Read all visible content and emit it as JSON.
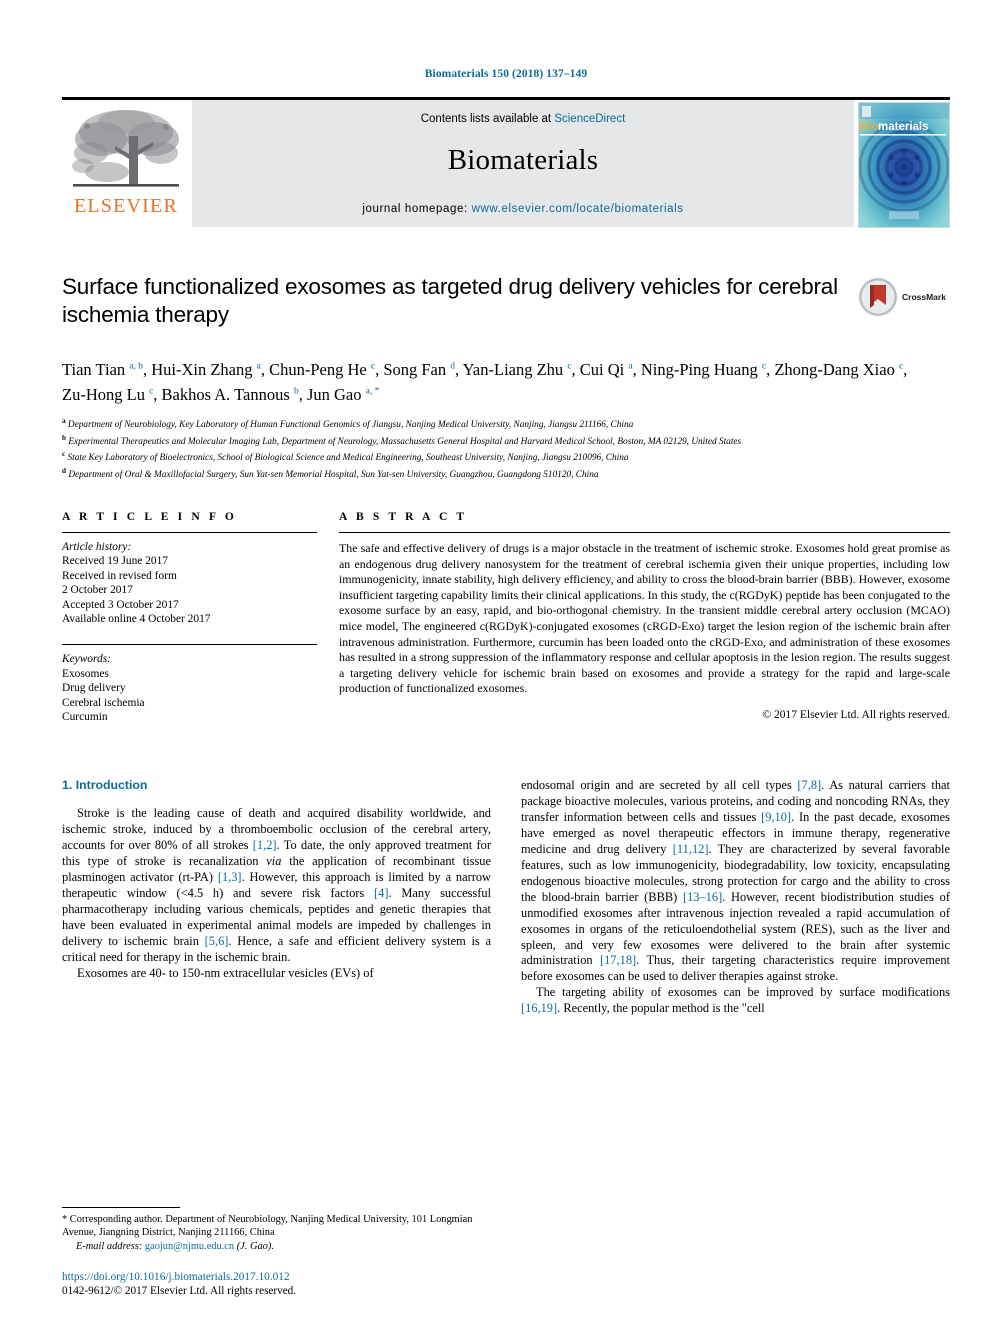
{
  "running_head": "Biomaterials 150 (2018) 137–149",
  "masthead": {
    "publisher_name": "ELSEVIER",
    "contents_prefix": "Contents lists available at ",
    "contents_link": "ScienceDirect",
    "journal_title": "Biomaterials",
    "homepage_prefix": "journal homepage: ",
    "homepage_url": "www.elsevier.com/locate/biomaterials",
    "cover_title": "Biomaterials",
    "cover_title_prefix": "Bio",
    "cover_title_suffix": "materials"
  },
  "article": {
    "title": "Surface functionalized exosomes as targeted drug delivery vehicles for cerebral ischemia therapy",
    "crossmark_label": "CrossMark"
  },
  "authors": [
    {
      "name": "Tian Tian",
      "sup": "a, b",
      "sep": ", "
    },
    {
      "name": "Hui-Xin Zhang",
      "sup": "a",
      "sep": ", "
    },
    {
      "name": "Chun-Peng He",
      "sup": "c",
      "sep": ", "
    },
    {
      "name": "Song Fan",
      "sup": "d",
      "sep": ", "
    },
    {
      "name": "Yan-Liang Zhu",
      "sup": "c",
      "sep": ", "
    },
    {
      "name": "Cui Qi",
      "sup": "a",
      "sep": ", "
    },
    {
      "name": "Ning-Ping Huang",
      "sup": "c",
      "sep": ", "
    },
    {
      "name": "Zhong-Dang Xiao",
      "sup": "c",
      "sep": ", "
    },
    {
      "name": "Zu-Hong Lu",
      "sup": "c",
      "sep": ", "
    },
    {
      "name": "Bakhos A. Tannous",
      "sup": "b",
      "sep": ", "
    },
    {
      "name": "Jun Gao",
      "sup": "a, *",
      "sep": ""
    }
  ],
  "affiliations": [
    {
      "mark": "a",
      "text": "Department of Neurobiology, Key Laboratory of Human Functional Genomics of Jiangsu, Nanjing Medical University, Nanjing, Jiangsu 211166, China"
    },
    {
      "mark": "b",
      "text": "Experimental Therapeutics and Molecular Imaging Lab, Department of Neurology, Massachusetts General Hospital and Harvard Medical School, Boston, MA 02129, United States"
    },
    {
      "mark": "c",
      "text": "State Key Laboratory of Bioelectronics, School of Biological Science and Medical Engineering, Southeast University, Nanjing, Jiangsu 210096, China"
    },
    {
      "mark": "d",
      "text": "Department of Oral & Maxillofacial Surgery, Sun Yat-sen Memorial Hospital, Sun Yat-sen University, Guangzhou, Guangdong 510120, China"
    }
  ],
  "article_info": {
    "heading": "A R T I C L E  I N F O",
    "history_label": "Article history:",
    "history": [
      "Received 19 June 2017",
      "Received in revised form",
      "2 October 2017",
      "Accepted 3 October 2017",
      "Available online 4 October 2017"
    ],
    "keywords_label": "Keywords:",
    "keywords": [
      "Exosomes",
      "Drug delivery",
      "Cerebral ischemia",
      "Curcumin"
    ]
  },
  "abstract": {
    "heading": "A B S T R A C T",
    "text": "The safe and effective delivery of drugs is a major obstacle in the treatment of ischemic stroke. Exosomes hold great promise as an endogenous drug delivery nanosystem for the treatment of cerebral ischemia given their unique properties, including low immunogenicity, innate stability, high delivery efficiency, and ability to cross the blood-brain barrier (BBB). However, exosome insufficient targeting capability limits their clinical applications. In this study, the c(RGDyK) peptide has been conjugated to the exosome surface by an easy, rapid, and bio-orthogonal chemistry. In the transient middle cerebral artery occlusion (MCAO) mice model, The engineered c(RGDyK)-conjugated exosomes (cRGD-Exo) target the lesion region of the ischemic brain after intravenous administration. Furthermore, curcumin has been loaded onto the cRGD-Exo, and administration of these exosomes has resulted in a strong suppression of the inflammatory response and cellular apoptosis in the lesion region. The results suggest a targeting delivery vehicle for ischemic brain based on exosomes and provide a strategy for the rapid and large-scale production of functionalized exosomes.",
    "copyright": "© 2017 Elsevier Ltd. All rights reserved."
  },
  "body": {
    "section_number": "1.",
    "section_title": "Introduction",
    "left_paragraphs": [
      "Stroke is the leading cause of death and acquired disability worldwide, and ischemic stroke, induced by a thromboembolic occlusion of the cerebral artery, accounts for over 80% of all strokes [1,2]. To date, the only approved treatment for this type of stroke is recanalization via the application of recombinant tissue plasminogen activator (rt-PA) [1,3]. However, this approach is limited by a narrow therapeutic window (<4.5 h) and severe risk factors [4]. Many successful pharmacotherapy including various chemicals, peptides and genetic therapies that have been evaluated in experimental animal models are impeded by challenges in delivery to ischemic brain [5,6]. Hence, a safe and efficient delivery system is a critical need for therapy in the ischemic brain.",
      "Exosomes are 40- to 150-nm extracellular vesicles (EVs) of"
    ],
    "right_paragraphs": [
      "endosomal origin and are secreted by all cell types [7,8]. As natural carriers that package bioactive molecules, various proteins, and coding and noncoding RNAs, they transfer information between cells and tissues [9,10]. In the past decade, exosomes have emerged as novel therapeutic effectors in immune therapy, regenerative medicine and drug delivery [11,12]. They are characterized by several favorable features, such as low immunogenicity, biodegradability, low toxicity, encapsulating endogenous bioactive molecules, strong protection for cargo and the ability to cross the blood-brain barrier (BBB) [13–16]. However, recent biodistribution studies of unmodified exosomes after intravenous injection revealed a rapid accumulation of exosomes in organs of the reticuloendothelial system (RES), such as the liver and spleen, and very few exosomes were delivered to the brain after systemic administration [17,18]. Thus, their targeting characteristics require improvement before exosomes can be used to deliver therapies against stroke.",
      "The targeting ability of exosomes can be improved by surface modifications [16,19]. Recently, the popular method is the \"cell"
    ]
  },
  "footnote": {
    "corresponding": "* Corresponding author. Department of Neurobiology, Nanjing Medical University, 101 Longmian Avenue, Jiangning District, Nanjing 211166, China",
    "email_label": "E-mail address:",
    "email": "gaojun@njmu.edu.cn",
    "email_suffix": "(J. Gao).",
    "doi": "https://doi.org/10.1016/j.biomaterials.2017.10.012",
    "issn_line": "0142-9612/© 2017 Elsevier Ltd. All rights reserved."
  },
  "colors": {
    "link": "#0b6a9c",
    "elsevier_orange": "#E9711C",
    "band_gray": "#e6e7e8"
  }
}
